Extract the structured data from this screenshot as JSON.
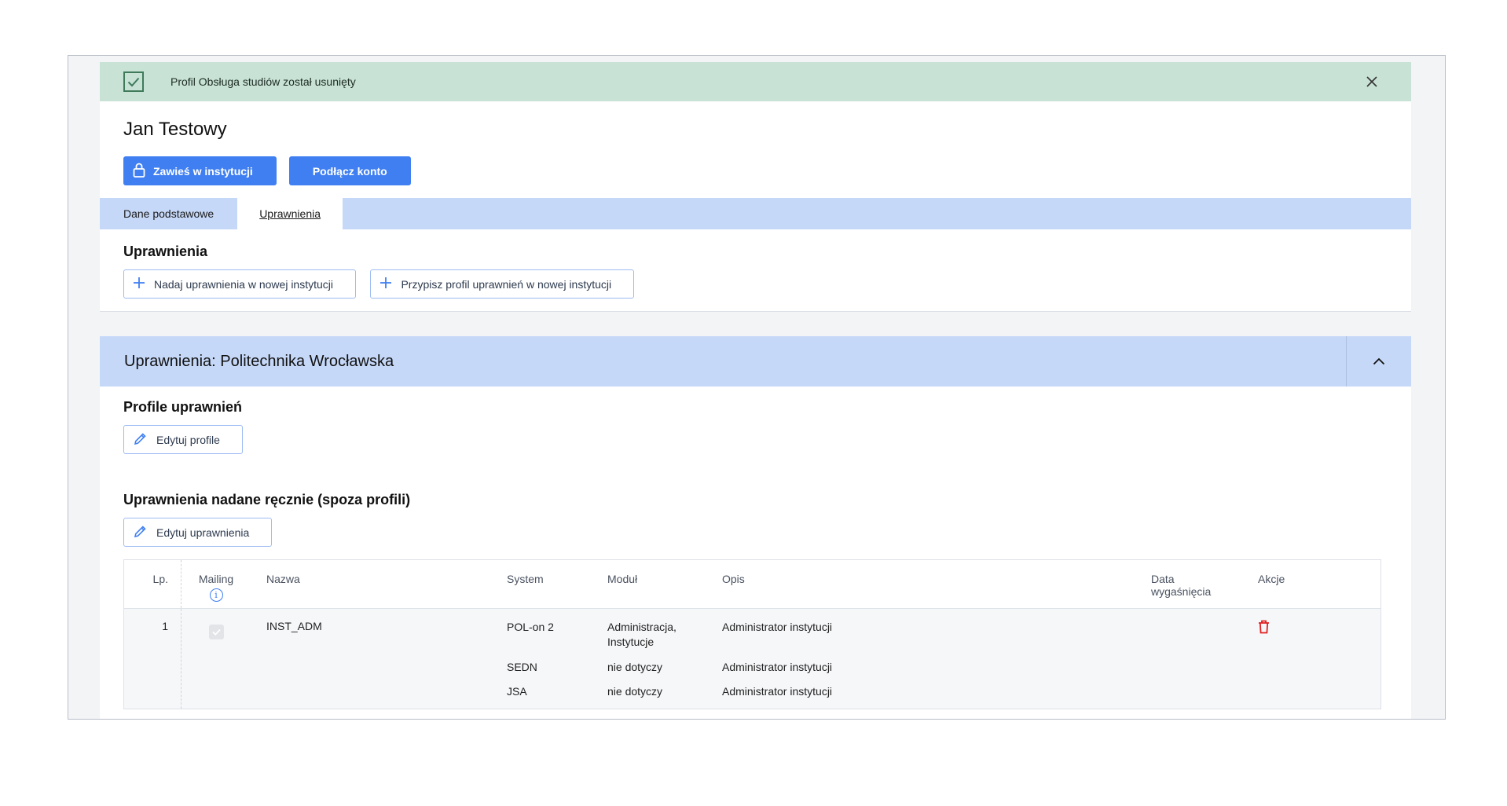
{
  "alert": {
    "message": "Profil Obsługa studiów został usunięty",
    "icon": "check-icon",
    "close_icon": "close-icon",
    "bg_color": "#c8e2d5"
  },
  "user": {
    "name": "Jan Testowy"
  },
  "actions": {
    "suspend_label": "Zawieś w instytucji",
    "connect_label": "Podłącz konto",
    "accent_color": "#3f7ff2"
  },
  "tabs": [
    {
      "label": "Dane podstawowe",
      "active": false
    },
    {
      "label": "Uprawnienia",
      "active": true
    }
  ],
  "permissions": {
    "title": "Uprawnienia",
    "grant_new_label": "Nadaj uprawnienia w nowej instytucji",
    "assign_profile_label": "Przypisz profil uprawnień w nowej instytucji"
  },
  "institution": {
    "title": "Uprawnienia: Politechnika Wrocławska",
    "profiles_title": "Profile uprawnień",
    "edit_profiles_label": "Edytuj profile",
    "manual_title": "Uprawnienia nadane ręcznie (spoza profili)",
    "edit_permissions_label": "Edytuj uprawnienia"
  },
  "table": {
    "headers": {
      "lp": "Lp.",
      "mailing": "Mailing",
      "nazwa": "Nazwa",
      "system": "System",
      "modul": "Moduł",
      "opis": "Opis",
      "data_line1": "Data",
      "data_line2": "wygaśnięcia",
      "akcje": "Akcje"
    },
    "rows": [
      {
        "lp": "1",
        "mailing_checked": true,
        "nazwa": "INST_ADM",
        "entries": [
          {
            "system": "POL-on 2",
            "modul_line1": "Administracja,",
            "modul_line2": "Instytucje",
            "opis": "Administrator instytucji"
          },
          {
            "system": "SEDN",
            "modul_line1": "nie dotyczy",
            "modul_line2": "",
            "opis": "Administrator instytucji"
          },
          {
            "system": "JSA",
            "modul_line1": "nie dotyczy",
            "modul_line2": "",
            "opis": "Administrator instytucji"
          }
        ]
      }
    ]
  }
}
